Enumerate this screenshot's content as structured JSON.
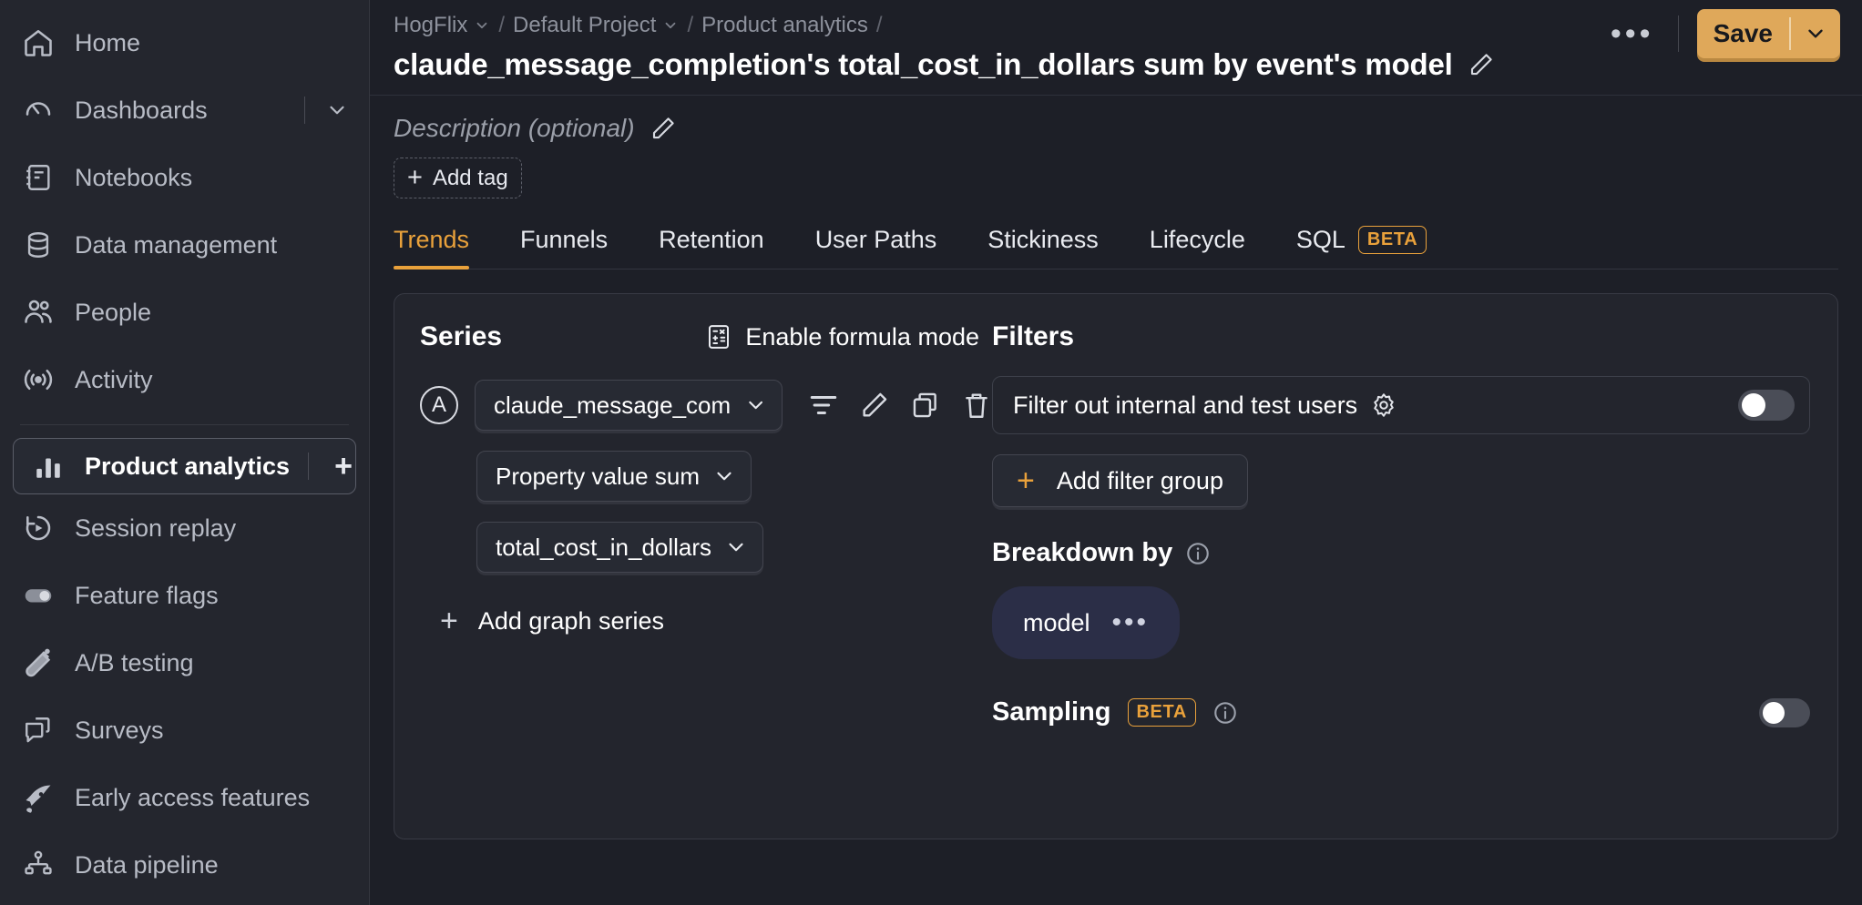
{
  "sidebar": {
    "items": [
      {
        "label": "Home",
        "icon": "home-icon",
        "selected": false,
        "hasChevron": false,
        "hasPlus": false
      },
      {
        "label": "Dashboards",
        "icon": "dashboard-gauge-icon",
        "selected": false,
        "hasChevron": true,
        "hasPlus": false
      },
      {
        "label": "Notebooks",
        "icon": "notebook-icon",
        "selected": false,
        "hasChevron": false,
        "hasPlus": false
      },
      {
        "label": "Data management",
        "icon": "database-icon",
        "selected": false,
        "hasChevron": false,
        "hasPlus": false
      },
      {
        "label": "People",
        "icon": "people-icon",
        "selected": false,
        "hasChevron": false,
        "hasPlus": false
      },
      {
        "label": "Activity",
        "icon": "activity-broadcast-icon",
        "selected": false,
        "hasChevron": false,
        "hasPlus": false
      }
    ],
    "items2": [
      {
        "label": "Product analytics",
        "icon": "bar-chart-icon",
        "selected": true,
        "hasChevron": false,
        "hasPlus": true
      },
      {
        "label": "Session replay",
        "icon": "session-replay-icon",
        "selected": false,
        "hasChevron": false,
        "hasPlus": false
      },
      {
        "label": "Feature flags",
        "icon": "toggle-icon",
        "selected": false,
        "hasChevron": false,
        "hasPlus": false
      },
      {
        "label": "A/B testing",
        "icon": "flask-icon",
        "selected": false,
        "hasChevron": false,
        "hasPlus": false
      },
      {
        "label": "Surveys",
        "icon": "speech-bubbles-icon",
        "selected": false,
        "hasChevron": false,
        "hasPlus": false
      },
      {
        "label": "Early access features",
        "icon": "rocket-icon",
        "selected": false,
        "hasChevron": false,
        "hasPlus": false
      },
      {
        "label": "Data pipeline",
        "icon": "pipeline-icon",
        "selected": false,
        "hasChevron": false,
        "hasPlus": false
      }
    ]
  },
  "header": {
    "breadcrumbs": [
      {
        "label": "HogFlix",
        "hasChevron": true
      },
      {
        "label": "Default Project",
        "hasChevron": true
      },
      {
        "label": "Product analytics",
        "hasChevron": false
      }
    ],
    "title": "claude_message_completion's total_cost_in_dollars sum by event's model",
    "edit_icon": "pencil-icon",
    "more_label": "•••",
    "save_label": "Save",
    "save_color": "#dfa85a"
  },
  "meta": {
    "description_placeholder": "Description (optional)",
    "description_edit_icon": "pencil-icon",
    "add_tag_label": "Add tag",
    "add_tag_plus": "+"
  },
  "tabs": [
    {
      "label": "Trends",
      "active": true,
      "badge": ""
    },
    {
      "label": "Funnels",
      "active": false,
      "badge": ""
    },
    {
      "label": "Retention",
      "active": false,
      "badge": ""
    },
    {
      "label": "User Paths",
      "active": false,
      "badge": ""
    },
    {
      "label": "Stickiness",
      "active": false,
      "badge": ""
    },
    {
      "label": "Lifecycle",
      "active": false,
      "badge": ""
    },
    {
      "label": "SQL",
      "active": false,
      "badge": "BETA"
    }
  ],
  "series": {
    "title": "Series",
    "formula_mode_label": "Enable formula mode",
    "formula_icon": "calculator-icon",
    "row": {
      "badge": "A",
      "event_value": "claude_message_completion",
      "event_display": "claude_message_completi",
      "math_value": "Property value sum",
      "property_value": "total_cost_in_dollars",
      "icons": [
        {
          "name": "filter-icon"
        },
        {
          "name": "pencil-icon"
        },
        {
          "name": "duplicate-icon"
        },
        {
          "name": "trash-icon"
        }
      ]
    },
    "add_series_label": "Add graph series",
    "add_series_plus": "+"
  },
  "filters": {
    "title": "Filters",
    "internal_users_label": "Filter out internal and test users",
    "internal_users_gear": "gear-icon",
    "internal_users_enabled": false,
    "add_filter_group_label": "Add filter group",
    "add_filter_group_plus": "+",
    "breakdown_title": "Breakdown by",
    "breakdown_info_icon": "info-icon",
    "breakdown_chip": "model",
    "breakdown_chip_more": "•••",
    "sampling_title": "Sampling",
    "sampling_badge": "BETA",
    "sampling_info_icon": "info-icon",
    "sampling_enabled": false
  },
  "colors": {
    "accent": "#e9a13b",
    "panel_bg": "#23252d",
    "app_bg": "#1d1f27",
    "sidebar_bg": "#24262e",
    "breakdown_chip_bg": "#2b2e47"
  }
}
